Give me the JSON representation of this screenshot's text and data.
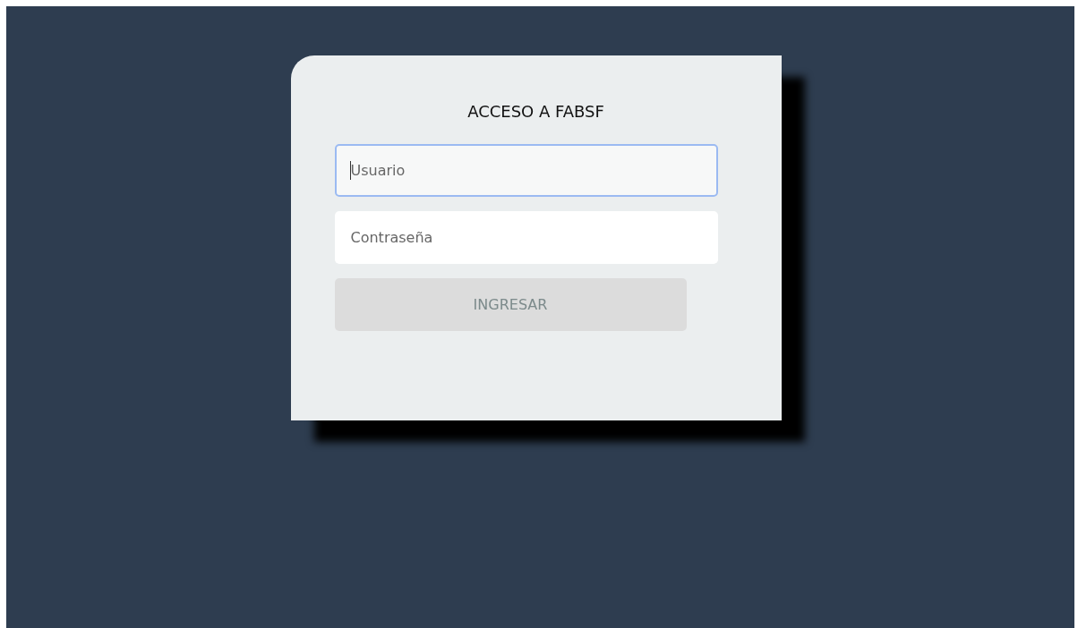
{
  "title": "ACCESO A FABSF",
  "fields": [
    {
      "placeholder": "Usuario",
      "focused": true
    },
    {
      "placeholder": "Contraseña",
      "focused": false
    }
  ],
  "button": {
    "label": "INGRESAR",
    "disabled": true
  }
}
